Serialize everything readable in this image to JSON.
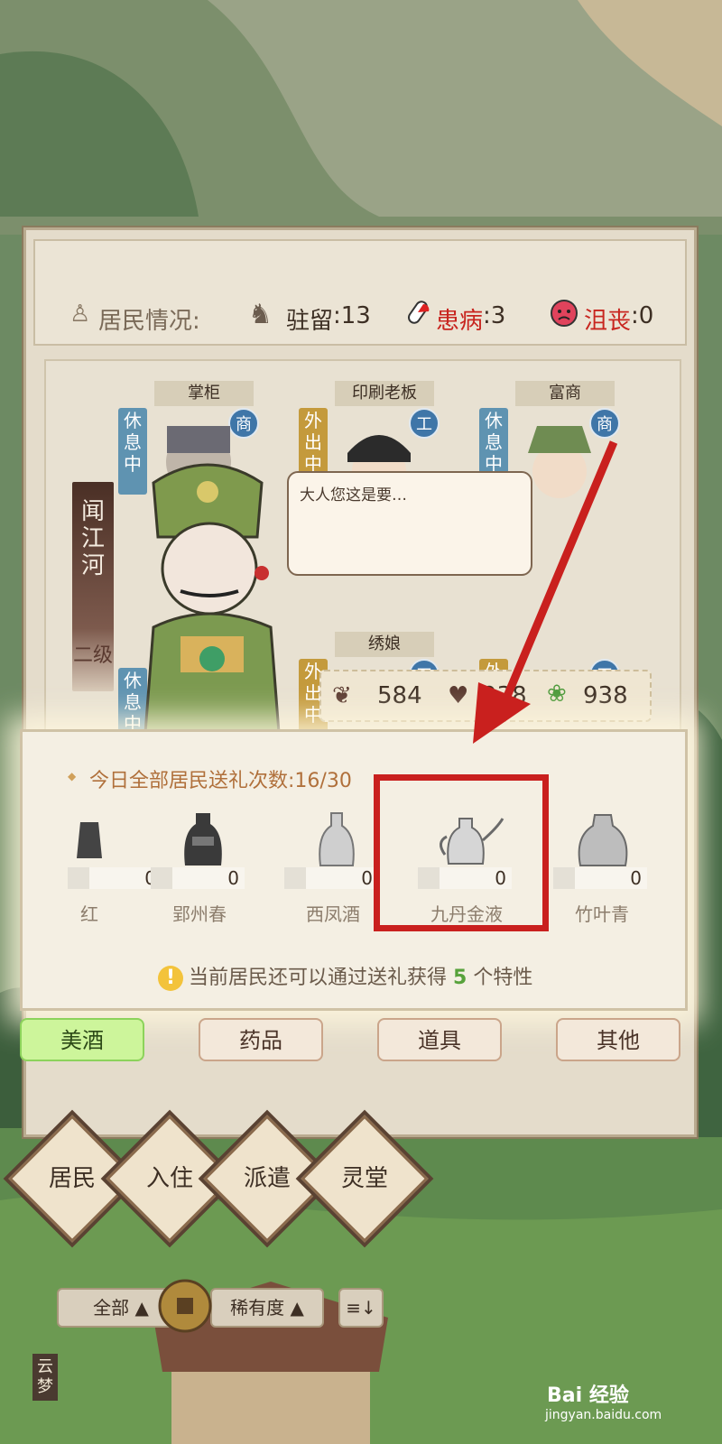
{
  "status": {
    "label": "居民情况:",
    "stay_label": "驻留",
    "stay_value": ":13",
    "sick_label": "患病",
    "sick_value": ":3",
    "sad_label": "沮丧",
    "sad_value": ":0"
  },
  "residents": [
    {
      "name": "掌柜",
      "state": "休息中",
      "type": "商"
    },
    {
      "name": "印刷老板",
      "state": "外出中",
      "type": "工"
    },
    {
      "name": "富商",
      "state": "休息中",
      "type": "商"
    },
    {
      "name": "",
      "state": "休息中",
      "type": ""
    },
    {
      "name": "绣娘",
      "state": "外出中",
      "type": "工"
    },
    {
      "name": "",
      "state": "外",
      "type": "工"
    }
  ],
  "selected": {
    "name": "闻江河",
    "level": "二级",
    "speech": "大人您这是要…",
    "stat1": "584",
    "stat2": "938",
    "stat3": "938"
  },
  "gift": {
    "header": "今日全部居民送礼次数:16/30",
    "items": [
      {
        "name": "红",
        "count": "0"
      },
      {
        "name": "郢州春",
        "count": "0"
      },
      {
        "name": "西凤酒",
        "count": "0"
      },
      {
        "name": "九丹金液",
        "count": "0"
      },
      {
        "name": "竹叶青",
        "count": "0"
      }
    ],
    "hint_pre": "当前居民还可以通过送礼获得",
    "hint_num": "5",
    "hint_post": "个特性"
  },
  "tabs": [
    "美酒",
    "药品",
    "道具",
    "其他"
  ],
  "filters": {
    "all": "全部",
    "rarity": "稀有度",
    "sort": "≡↓"
  },
  "nav": [
    "居民",
    "入住",
    "派遣",
    "灵堂"
  ],
  "bottom": {
    "town": "云梦",
    "watermark": "Bai 经验",
    "watermark_sub": "jingyan.baidu.com"
  }
}
